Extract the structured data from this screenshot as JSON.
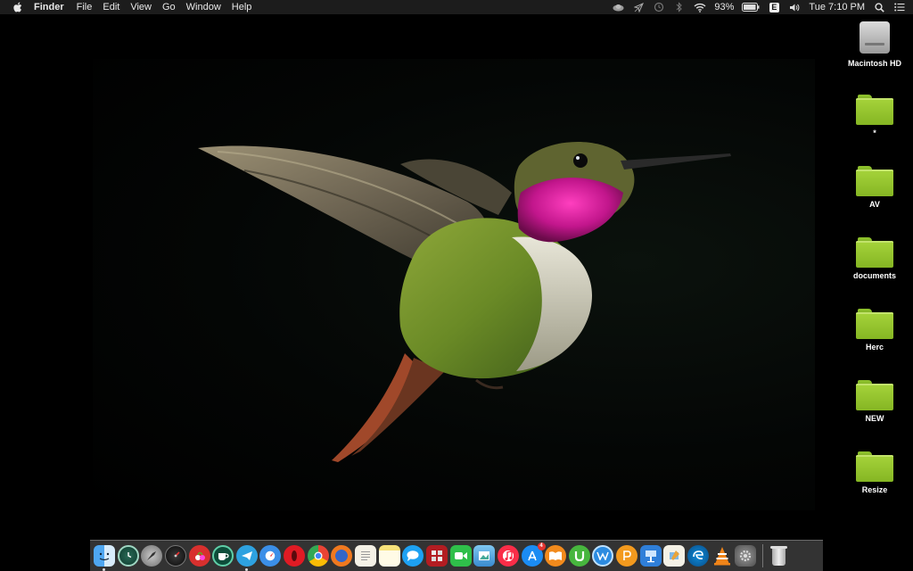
{
  "menubar": {
    "apple_icon": "apple-icon",
    "app_name": "Finder",
    "menus": [
      "File",
      "Edit",
      "View",
      "Go",
      "Window",
      "Help"
    ],
    "status": {
      "battery_percent": "93%",
      "input_source": "E",
      "clock": "Tue 7:10 PM"
    }
  },
  "desktop": {
    "wallpaper": "hummingbird-photo",
    "icons": [
      {
        "label": "Macintosh HD",
        "kind": "hard-drive"
      },
      {
        "label": "*",
        "kind": "folder"
      },
      {
        "label": "AV",
        "kind": "folder"
      },
      {
        "label": "documents",
        "kind": "folder"
      },
      {
        "label": "Herc",
        "kind": "folder"
      },
      {
        "label": "NEW",
        "kind": "folder"
      },
      {
        "label": "Resize",
        "kind": "folder"
      }
    ]
  },
  "dock": {
    "apps": [
      {
        "icon": "finder-icon",
        "running": true
      },
      {
        "icon": "time-machine-icon"
      },
      {
        "icon": "launchpad-icon"
      },
      {
        "icon": "dashboard-icon"
      },
      {
        "icon": "cherry-app-icon"
      },
      {
        "icon": "coffee-app-icon"
      },
      {
        "icon": "telegram-icon",
        "running": true
      },
      {
        "icon": "safari-icon"
      },
      {
        "icon": "opera-icon"
      },
      {
        "icon": "chrome-icon"
      },
      {
        "icon": "firefox-icon"
      },
      {
        "icon": "textedit-icon"
      },
      {
        "icon": "notes-icon"
      },
      {
        "icon": "messages-icon"
      },
      {
        "icon": "photo-booth-icon"
      },
      {
        "icon": "facetime-icon"
      },
      {
        "icon": "preview-icon"
      },
      {
        "icon": "itunes-icon"
      },
      {
        "icon": "app-store-icon",
        "badge": "4"
      },
      {
        "icon": "ibooks-icon"
      },
      {
        "icon": "utorrent-icon"
      },
      {
        "icon": "word-app-icon"
      },
      {
        "icon": "pages-app-icon"
      },
      {
        "icon": "keynote-icon"
      },
      {
        "icon": "sketch-app-icon"
      },
      {
        "icon": "edge-icon"
      },
      {
        "icon": "vlc-icon"
      },
      {
        "icon": "system-preferences-icon"
      }
    ],
    "trash_icon": "trash-icon"
  }
}
